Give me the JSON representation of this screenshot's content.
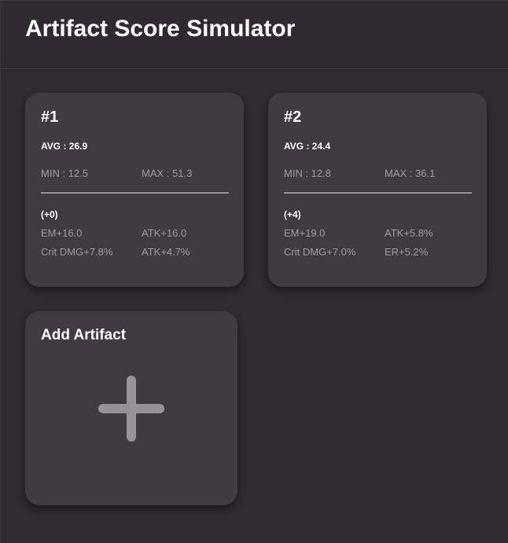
{
  "header": {
    "title": "Artifact Score Simulator"
  },
  "artifacts": [
    {
      "title": "#1",
      "avg": "AVG : 26.9",
      "min": "MIN : 12.5",
      "max": "MAX : 51.3",
      "level": "(+0)",
      "substats": [
        "EM+16.0",
        "ATK+16.0",
        "Crit DMG+7.8%",
        "ATK+4.7%"
      ]
    },
    {
      "title": "#2",
      "avg": "AVG : 24.4",
      "min": "MIN : 12.8",
      "max": "MAX : 36.1",
      "level": "(+4)",
      "substats": [
        "EM+19.0",
        "ATK+5.8%",
        "Crit DMG+7.0%",
        "ER+5.2%"
      ]
    }
  ],
  "add_card": {
    "label": "Add Artifact",
    "icon": "plus-icon"
  },
  "colors": {
    "background": "#302b31",
    "card": "#403a41",
    "muted_text": "#a19ca2",
    "plus_icon": "#969396"
  }
}
